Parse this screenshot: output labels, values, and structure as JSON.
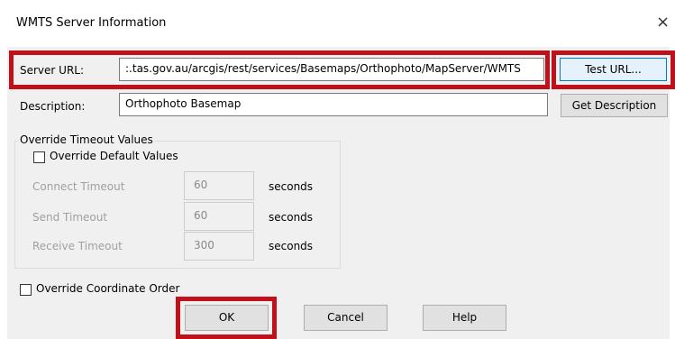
{
  "dialog": {
    "title": "WMTS Server Information",
    "close_glyph": "×"
  },
  "server_url": {
    "label": "Server URL:",
    "value": ":.tas.gov.au/arcgis/rest/services/Basemaps/Orthophoto/MapServer/WMTS",
    "test_button": "Test URL..."
  },
  "description": {
    "label": "Description:",
    "value": "Orthophoto Basemap",
    "get_button": "Get Description"
  },
  "timeout_group": {
    "title": "Override Timeout Values",
    "override_checkbox_label": "Override Default Values",
    "override_checked": false,
    "rows": [
      {
        "label": "Connect Timeout",
        "value": "60",
        "unit": "seconds"
      },
      {
        "label": "Send Timeout",
        "value": "60",
        "unit": "seconds"
      },
      {
        "label": "Receive Timeout",
        "value": "300",
        "unit": "seconds"
      }
    ]
  },
  "coordinate_order": {
    "label": "Override Coordinate Order",
    "checked": false
  },
  "buttons": {
    "ok": "OK",
    "cancel": "Cancel",
    "help": "Help"
  },
  "colors": {
    "highlight": "#c0111a",
    "panel": "#f0f0f0"
  }
}
